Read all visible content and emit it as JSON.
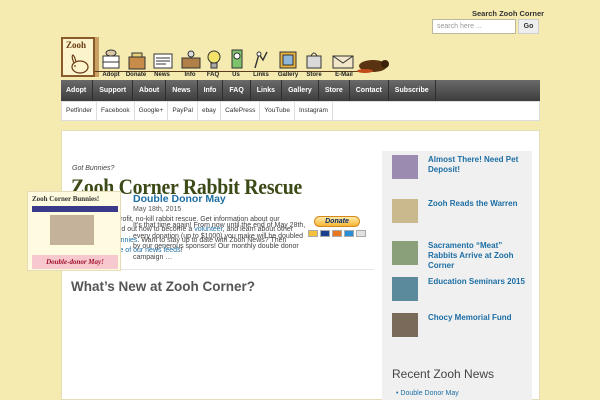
{
  "header": {
    "search_title": "Search Zooh Corner",
    "search_placeholder": "search here ...",
    "search_button": "Go",
    "logo_text": "Zooh"
  },
  "icon_nav": [
    {
      "label": "Adopt",
      "icon": "rabbit-hutch-icon"
    },
    {
      "label": "Donate",
      "icon": "donation-box-icon"
    },
    {
      "label": "News",
      "icon": "newspaper-icon"
    },
    {
      "label": "Info",
      "icon": "info-desk-icon"
    },
    {
      "label": "FAQ",
      "icon": "lightbulb-icon"
    },
    {
      "label": "Us",
      "icon": "bunny-group-icon"
    },
    {
      "label": "Links",
      "icon": "chain-link-icon"
    },
    {
      "label": "Gallery",
      "icon": "picture-frame-icon"
    },
    {
      "label": "Store",
      "icon": "store-bag-icon"
    },
    {
      "label": "E-Mail",
      "icon": "mail-icon"
    }
  ],
  "nav_primary": [
    "Adopt",
    "Support",
    "About",
    "News",
    "Info",
    "FAQ",
    "Links",
    "Gallery",
    "Store",
    "Contact",
    "Subscribe"
  ],
  "nav_secondary": [
    "Petfinder",
    "Facebook",
    "Google+",
    "PayPal",
    "ebay",
    "CafePress",
    "YouTube",
    "Instagram"
  ],
  "main": {
    "tagline": "Got Bunnies?",
    "title": "Zooh Corner Rabbit Rescue",
    "intro": {
      "p1": "We are a non-profit, no-kill rabbit rescue. Get information about our ",
      "link1": "organization",
      "p2": ", find out how to become a ",
      "link2": "volunteer",
      "p3": ", and learn about other ways to ",
      "link3": "help bunnies",
      "p4": ". Want to stay up to date with Zooh News? Then ",
      "link4": "subscribe to one of our news feeds",
      "p5": "!"
    },
    "donate_label": "Donate",
    "section_heading": "What’s New at Zooh Corner?",
    "post": {
      "thumb_title": "Zooh Corner Bunnies!",
      "thumb_footer": "Double-donor May!",
      "title": "Double Donor May",
      "date": "May 18th, 2015",
      "excerpt": "It’s that time again!  From now until the end of May 28th, every donation (up to $1000) you make will be doubled by our generous sponsors!  Our monthly double donor campaign …"
    }
  },
  "sidebar": {
    "featured": [
      {
        "title": "Almost There! Need Pet Deposit!"
      },
      {
        "title": "Zooh Reads the Warren"
      },
      {
        "title": "Sacramento “Meat” Rabbits Arrive at Zooh Corner"
      },
      {
        "title": "Education Seminars 2015"
      },
      {
        "title": "Chocy Memorial Fund"
      }
    ],
    "recent_heading": "Recent Zooh News",
    "recent": [
      "Double Donor May"
    ]
  },
  "colors": {
    "background": "#f5ebb0",
    "nav_dark": "#4a4a4a",
    "link_blue": "#1c6ea4",
    "title_green": "#3b4a16"
  }
}
